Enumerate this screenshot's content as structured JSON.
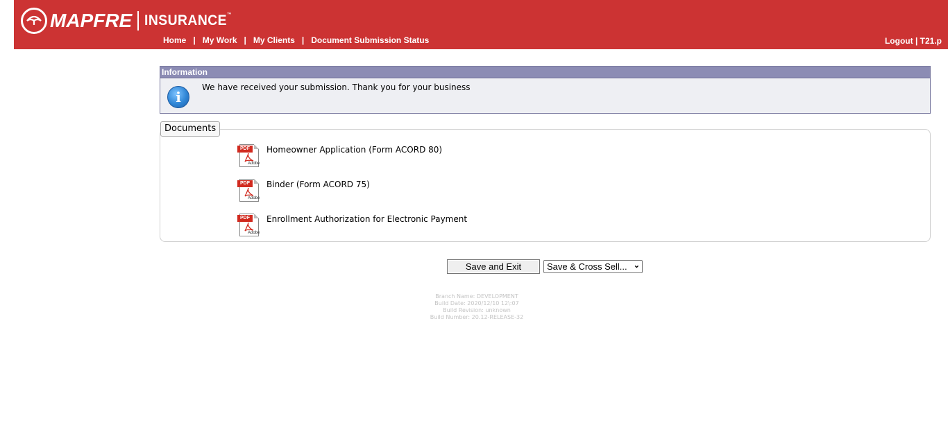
{
  "header": {
    "brand": "MAPFRE",
    "product": "INSURANCE",
    "trademark": "™",
    "nav": [
      "Home",
      "My Work",
      "My Clients",
      "Document Submission Status"
    ],
    "logout_label": "Logout",
    "user": "T21.p",
    "separator": "|"
  },
  "info": {
    "title": "Information",
    "message": "We have received your submission. Thank you for your business"
  },
  "documents": {
    "tab_label": "Documents",
    "items": [
      {
        "name": "Homeowner Application (Form ACORD 80)",
        "icon": "pdf-icon",
        "icon_label": "PDF",
        "icon_brand": "Adobe"
      },
      {
        "name": "Binder (Form ACORD 75)",
        "icon": "pdf-icon",
        "icon_label": "PDF",
        "icon_brand": "Adobe"
      },
      {
        "name": "Enrollment Authorization for Electronic Payment",
        "icon": "pdf-icon",
        "icon_label": "PDF",
        "icon_brand": "Adobe"
      }
    ]
  },
  "actions": {
    "save_exit_label": "Save and Exit",
    "cross_sell_selected": "Save & Cross Sell..."
  },
  "build": {
    "branch": "Branch Name: DEVELOPMENT",
    "date": "Build Date: 2020/12/10 12\\:07",
    "revision": "Build Revision: unknown",
    "number": "Build Number: 20.12-RELEASE-32"
  },
  "colors": {
    "header_bg": "#cc3333",
    "info_header_bg": "#8c8cb4",
    "info_bg": "#eeeff3"
  }
}
